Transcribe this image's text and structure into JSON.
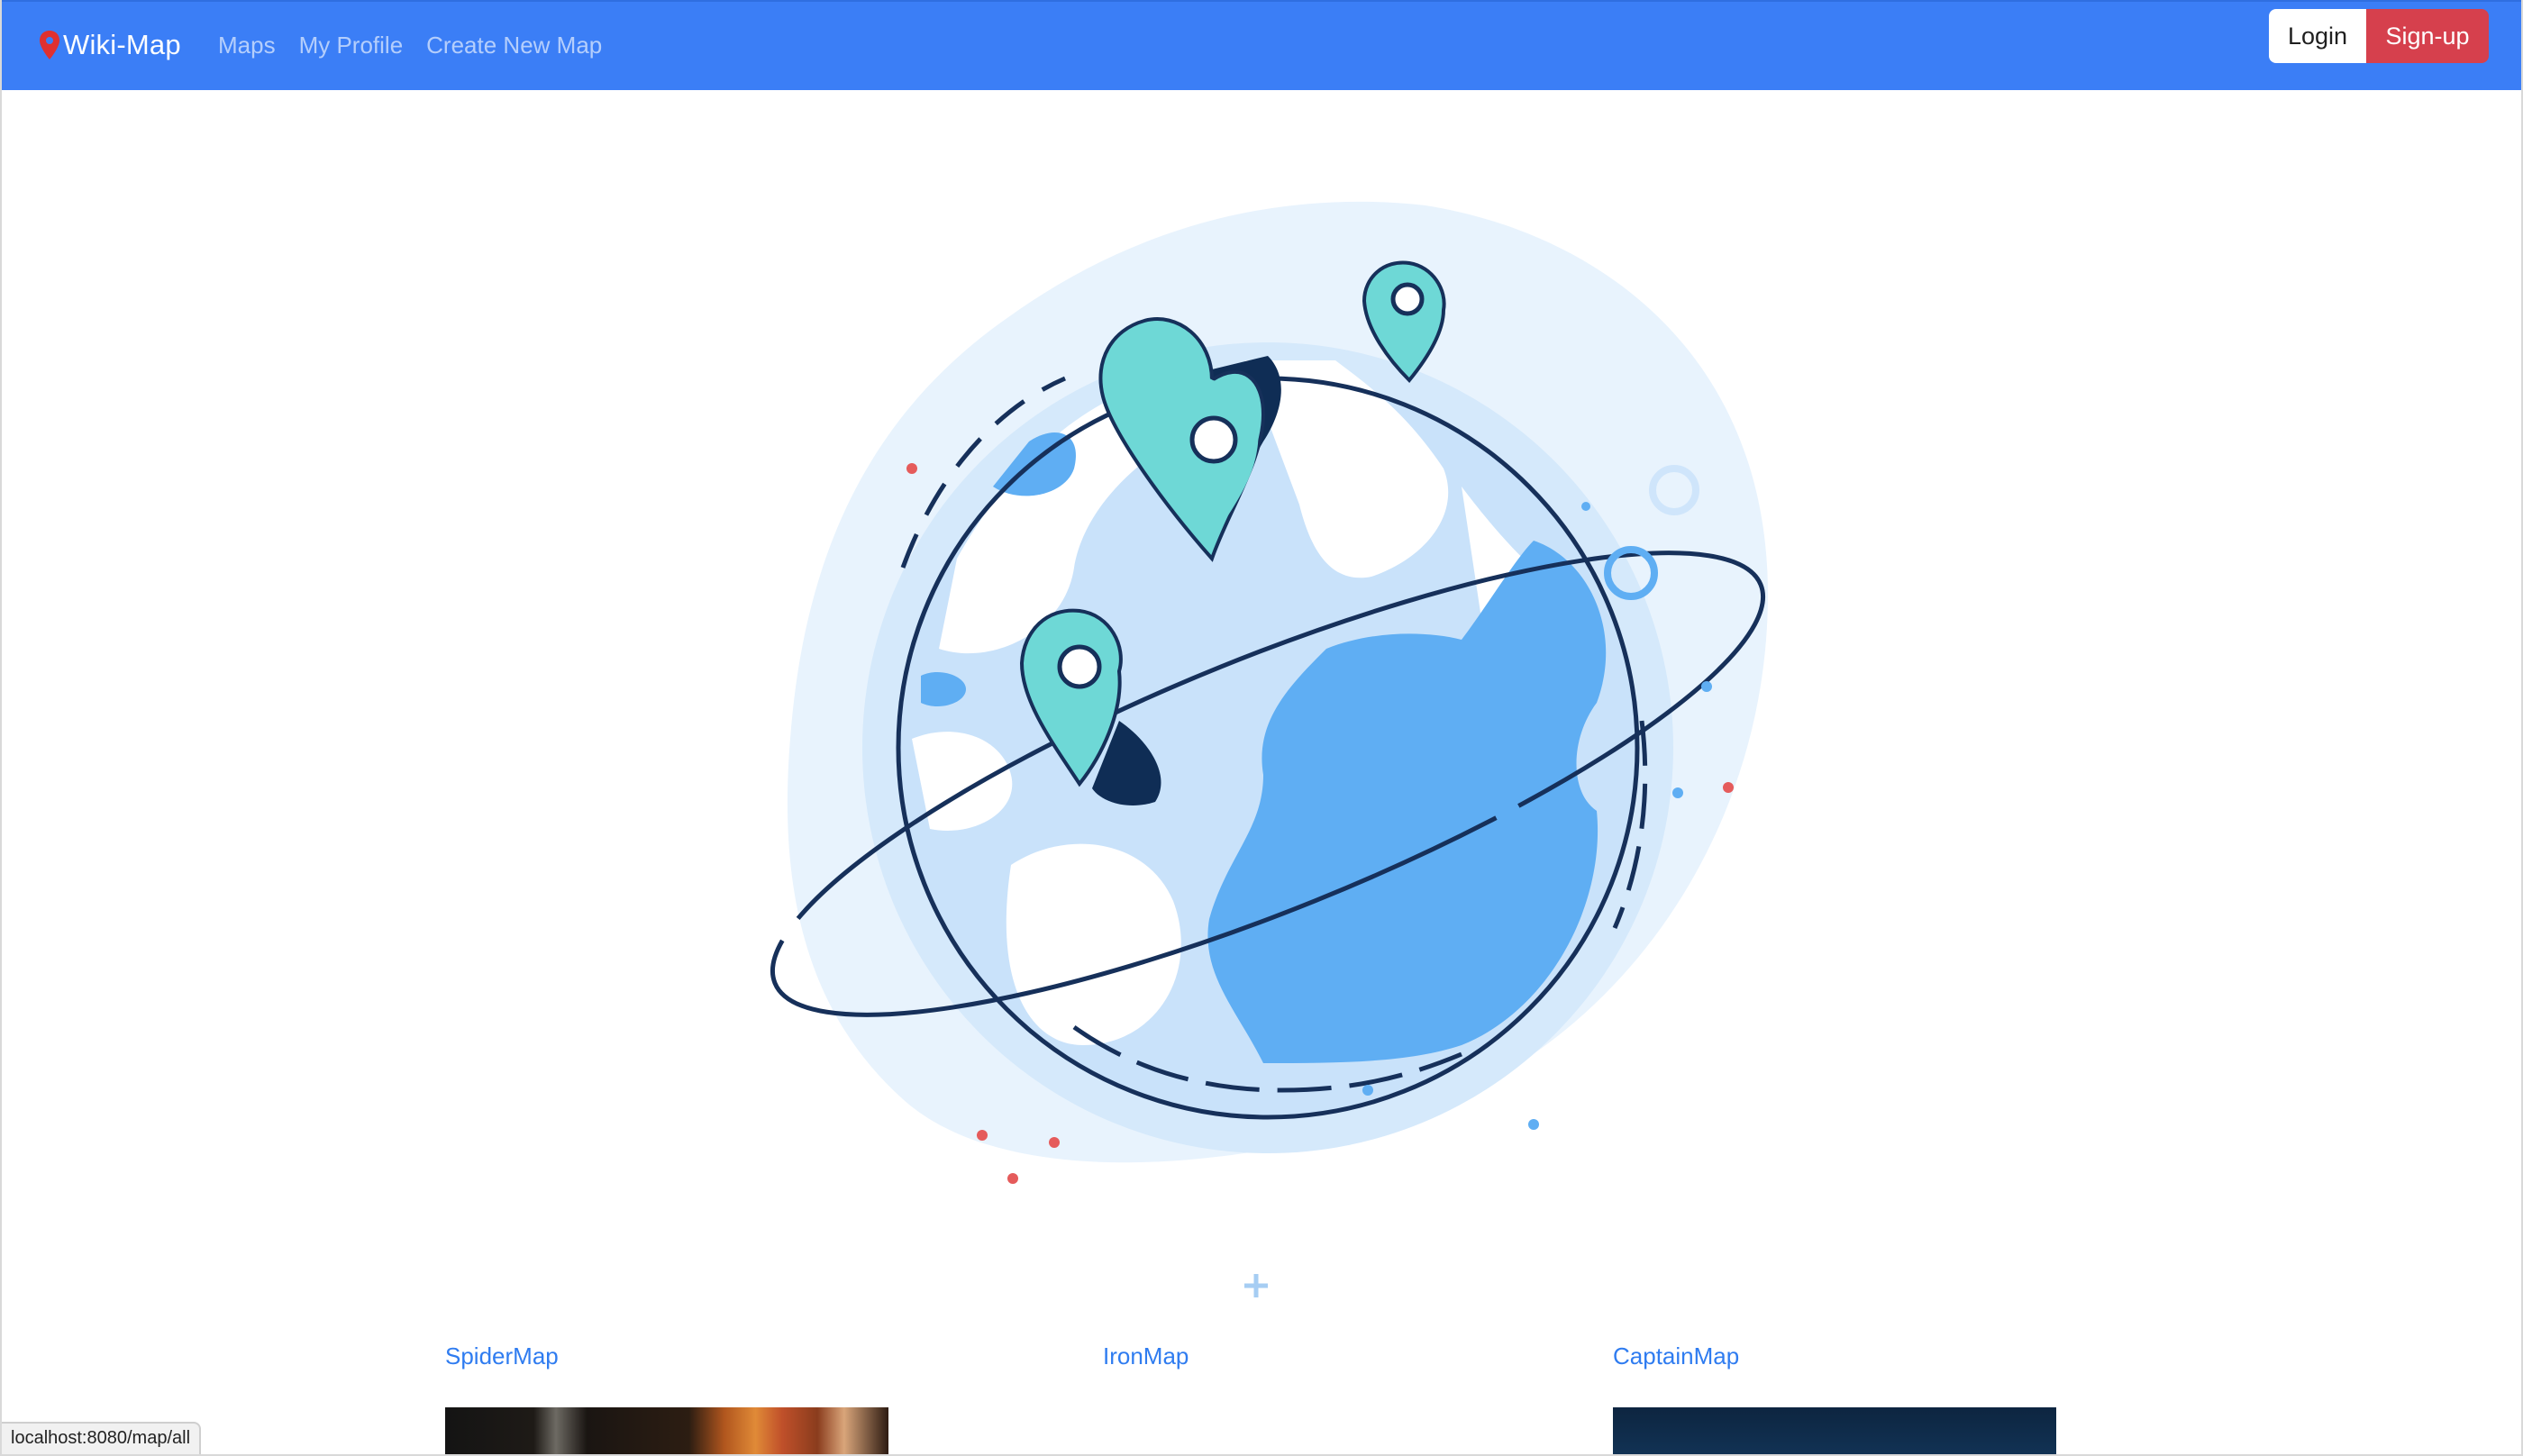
{
  "navbar": {
    "brand": "Wiki-Map",
    "links": [
      "Maps",
      "My Profile",
      "Create New Map"
    ],
    "login_label": "Login",
    "signup_label": "Sign-up",
    "colors": {
      "navbar": "#3b7ef6",
      "signup": "#d6404d",
      "pin": "#e0302f"
    }
  },
  "hero": {
    "illustration": "globe-with-map-pins-illustration"
  },
  "maps": [
    {
      "title": "SpiderMap"
    },
    {
      "title": "IronMap"
    },
    {
      "title": "CaptainMap"
    }
  ],
  "status_bar": {
    "url": "localhost:8080/map/all"
  }
}
